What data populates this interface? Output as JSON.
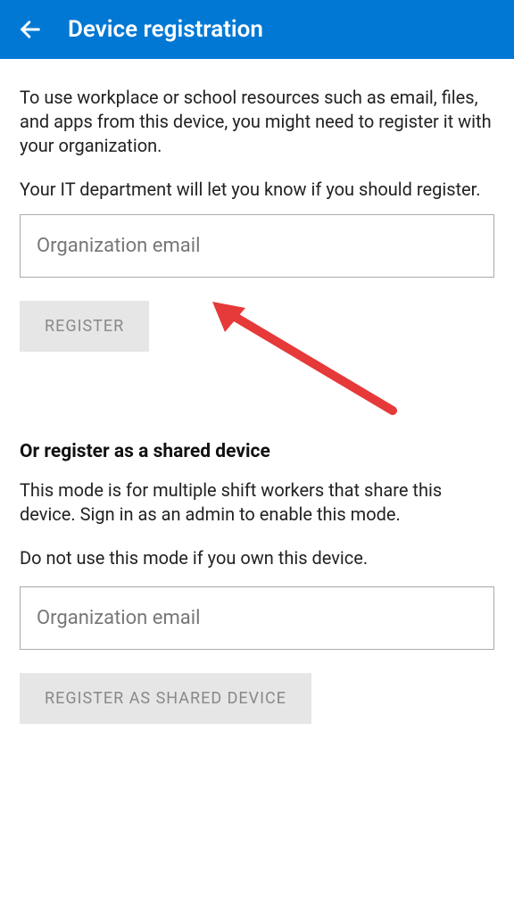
{
  "header": {
    "title": "Device registration"
  },
  "intro": {
    "paragraph1": "To use workplace or school resources such as email, files, and apps from this device, you might need to register it with your organization.",
    "paragraph2": "Your IT department will let you know if you should register."
  },
  "form": {
    "email_placeholder": "Organization email",
    "register_label": "REGISTER"
  },
  "shared": {
    "title": "Or register as a shared device",
    "description": "This mode is for multiple shift workers that share this device. Sign in as an admin to enable this mode.",
    "warning": "Do not use this mode if you own this device.",
    "email_placeholder": "Organization email",
    "register_label": "REGISTER AS SHARED DEVICE"
  },
  "colors": {
    "header_bg": "#0078d4",
    "arrow": "#e63939"
  }
}
